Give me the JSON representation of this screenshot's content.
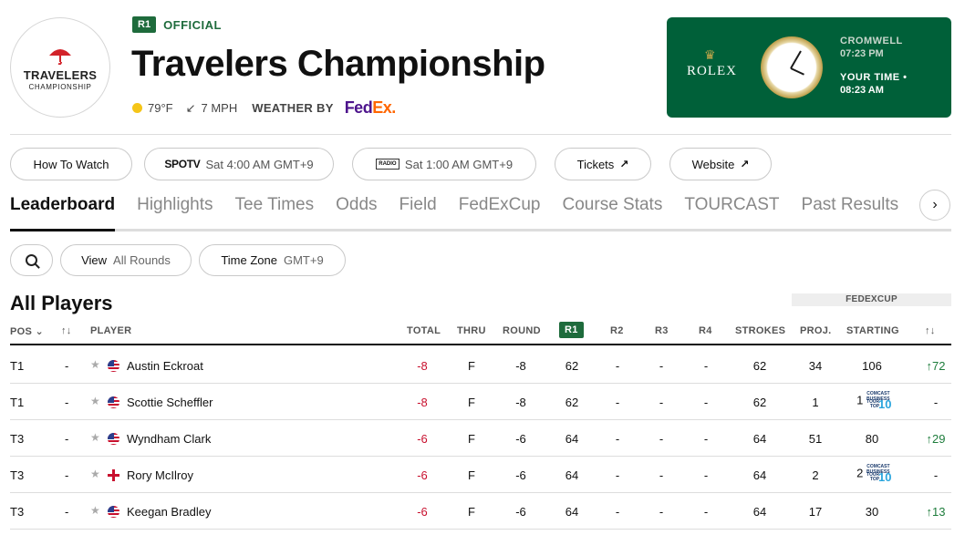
{
  "event": {
    "logo_line1": "TRAVELERS",
    "logo_line2": "CHAMPIONSHIP",
    "round_badge": "R1",
    "status": "OFFICIAL",
    "title": "Travelers Championship",
    "temperature": "79°F",
    "wind": "7 MPH",
    "weather_by": "WEATHER BY",
    "sponsor_fe": "Fed",
    "sponsor_ex": "Ex",
    "sponsor_dot": "."
  },
  "clock": {
    "brand": "ROLEX",
    "local_city": "CROMWELL",
    "local_time": "07:23 PM",
    "your_time_label": "YOUR TIME •",
    "your_time": "08:23 AM"
  },
  "actions": {
    "how_to_watch": "How To Watch",
    "tv_network": "SPOTV",
    "tv_time": "Sat 4:00 AM GMT+9",
    "radio_icon": "RADIO",
    "radio_time": "Sat 1:00 AM GMT+9",
    "tickets": "Tickets",
    "website": "Website"
  },
  "tabs": [
    "Leaderboard",
    "Highlights",
    "Tee Times",
    "Odds",
    "Field",
    "FedExCup",
    "Course Stats",
    "TOURCAST",
    "Past Results"
  ],
  "filters": {
    "view_label": "View",
    "view_value": "All Rounds",
    "tz_label": "Time Zone",
    "tz_value": "GMT+9"
  },
  "section_title": "All Players",
  "fedexcup_header": "FEDEXCUP",
  "columns": {
    "pos": "POS",
    "player": "PLAYER",
    "total": "TOTAL",
    "thru": "THRU",
    "round": "ROUND",
    "r1": "R1",
    "r2": "R2",
    "r3": "R3",
    "r4": "R4",
    "strokes": "STROKES",
    "proj": "PROJ.",
    "starting": "STARTING"
  },
  "top10": {
    "line1": "COMCAST",
    "line2": "BUSINESS",
    "line3": "TOUR",
    "line4": "TOP",
    "big": "1",
    "big2": "0"
  },
  "players": [
    {
      "pos": "T1",
      "move": "-",
      "flag": "us",
      "name": "Austin Eckroat",
      "total": "-8",
      "thru": "F",
      "round": "-8",
      "r1": "62",
      "r2": "-",
      "r3": "-",
      "r4": "-",
      "strokes": "62",
      "proj": "34",
      "starting": "106",
      "top10": false,
      "change": "↑72"
    },
    {
      "pos": "T1",
      "move": "-",
      "flag": "us",
      "name": "Scottie Scheffler",
      "total": "-8",
      "thru": "F",
      "round": "-8",
      "r1": "62",
      "r2": "-",
      "r3": "-",
      "r4": "-",
      "strokes": "62",
      "proj": "1",
      "starting": "1",
      "top10": true,
      "change": "-"
    },
    {
      "pos": "T3",
      "move": "-",
      "flag": "us",
      "name": "Wyndham Clark",
      "total": "-6",
      "thru": "F",
      "round": "-6",
      "r1": "64",
      "r2": "-",
      "r3": "-",
      "r4": "-",
      "strokes": "64",
      "proj": "51",
      "starting": "80",
      "top10": false,
      "change": "↑29"
    },
    {
      "pos": "T3",
      "move": "-",
      "flag": "ni",
      "name": "Rory McIlroy",
      "total": "-6",
      "thru": "F",
      "round": "-6",
      "r1": "64",
      "r2": "-",
      "r3": "-",
      "r4": "-",
      "strokes": "64",
      "proj": "2",
      "starting": "2",
      "top10": true,
      "change": "-"
    },
    {
      "pos": "T3",
      "move": "-",
      "flag": "us",
      "name": "Keegan Bradley",
      "total": "-6",
      "thru": "F",
      "round": "-6",
      "r1": "64",
      "r2": "-",
      "r3": "-",
      "r4": "-",
      "strokes": "64",
      "proj": "17",
      "starting": "30",
      "top10": false,
      "change": "↑13"
    }
  ]
}
